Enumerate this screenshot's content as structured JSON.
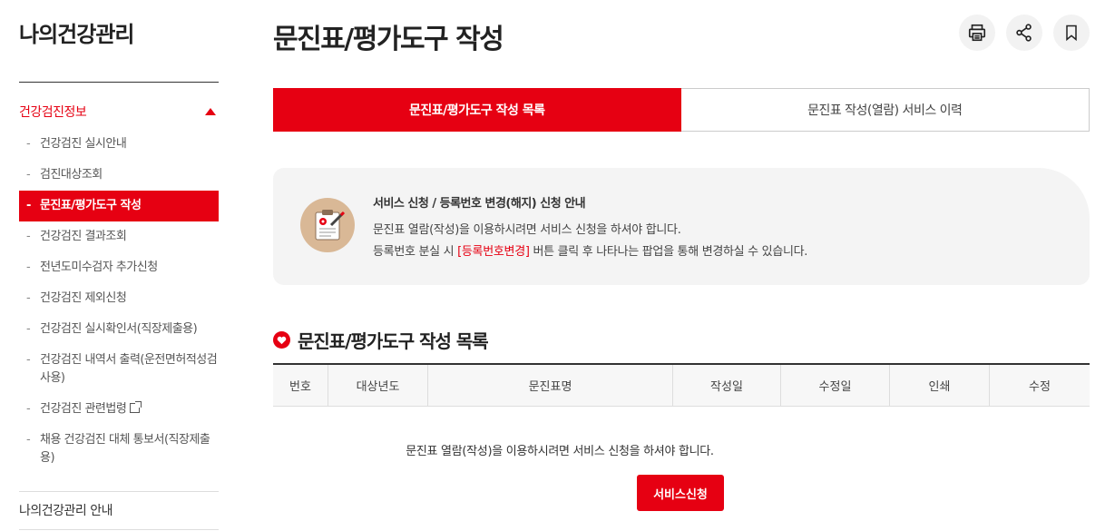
{
  "sidebar": {
    "title": "나의건강관리",
    "section": "건강검진정보",
    "items": [
      {
        "label": "건강검진 실시안내"
      },
      {
        "label": "검진대상조회"
      },
      {
        "label": "문진표/평가도구 작성"
      },
      {
        "label": "건강검진 결과조회"
      },
      {
        "label": "전년도미수검자 추가신청"
      },
      {
        "label": "건강검진 제외신청"
      },
      {
        "label": "건강검진 실시확인서(직장제출용)"
      },
      {
        "label": "건강검진 내역서 출력(운전면허적성검사용)"
      },
      {
        "label": "건강검진 관련법령"
      },
      {
        "label": "채용 건강검진 대체 통보서(직장제출용)"
      }
    ],
    "bottom": "나의건강관리 안내"
  },
  "page": {
    "title": "문진표/평가도구 작성",
    "actions": [
      "print-icon",
      "share-icon",
      "bookmark-icon"
    ]
  },
  "tabs": [
    {
      "label": "문진표/평가도구 작성 목록",
      "active": true
    },
    {
      "label": "문진표 작성(열람) 서비스 이력",
      "active": false
    }
  ],
  "notice": {
    "title": "서비스 신청 / 등록번호 변경(해지) 신청 안내",
    "line1": "문진표 열람(작성)을 이용하시려면 서비스 신청을 하셔야 합니다.",
    "line2_pre": "등록번호 분실 시 ",
    "line2_link": "[등록번호변경]",
    "line2_post": " 버튼 클릭 후 나타나는 팝업을 통해 변경하실 수 있습니다."
  },
  "list": {
    "title": "문진표/평가도구 작성 목록",
    "columns": [
      "번호",
      "대상년도",
      "문진표명",
      "작성일",
      "수정일",
      "인쇄",
      "수정"
    ],
    "empty_message": "문진표 열람(작성)을 이용하시려면 서비스 신청을 하셔야 합니다.",
    "apply_button": "서비스신청"
  },
  "colors": {
    "accent": "#e60012",
    "notice_bg": "#f4f4f4",
    "icon_bg": "#d9b896"
  }
}
